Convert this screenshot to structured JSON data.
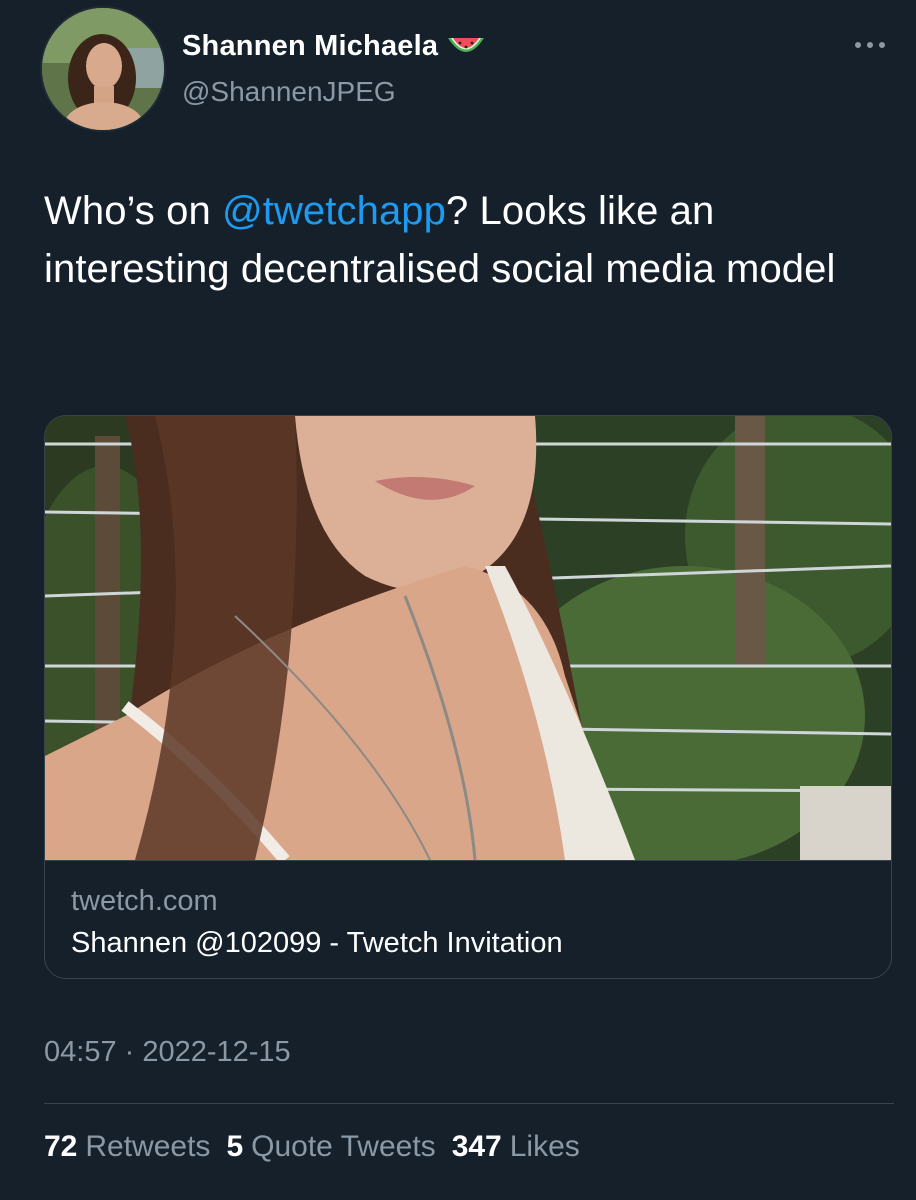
{
  "author": {
    "display_name": "Shannen Michaela",
    "name_emoji_icon": "watermelon-icon",
    "handle": "@ShannenJPEG"
  },
  "tweet": {
    "text_before": "Who’s on ",
    "mention": "@twetchapp",
    "text_after": "? Looks like an interesting decentralised social media model"
  },
  "card": {
    "domain": "twetch.com",
    "title": "Shannen @102099 - Twetch Invitation"
  },
  "timestamp": "04:57 · 2022-12-15",
  "stats": {
    "retweets_count": "72",
    "retweets_label": "Retweets",
    "quotes_count": "5",
    "quotes_label": "Quote Tweets",
    "likes_count": "347",
    "likes_label": "Likes"
  },
  "colors": {
    "background": "#15202b",
    "link": "#1d9bf0",
    "secondary_text": "#8b98a5",
    "border": "#38444d"
  }
}
